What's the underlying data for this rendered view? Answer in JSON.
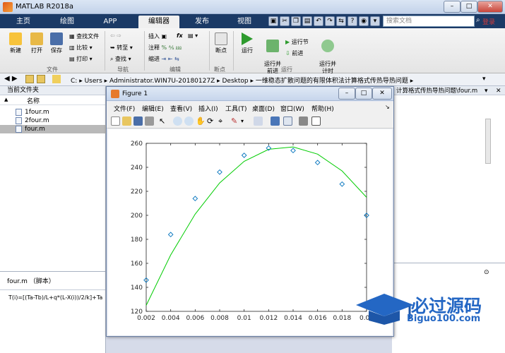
{
  "window": {
    "title": "MATLAB R2018a",
    "minimize": "–",
    "maximize": "□",
    "close": "✕"
  },
  "tabs": [
    {
      "label": "主页"
    },
    {
      "label": "绘图"
    },
    {
      "label": "APP"
    },
    {
      "label": "编辑器",
      "active": true
    },
    {
      "label": "发布"
    },
    {
      "label": "视图"
    }
  ],
  "search": {
    "placeholder": "搜索文档"
  },
  "login": "登录",
  "ribbon": {
    "file_group": "文件",
    "nav_group": "导航",
    "edit_group": "编辑",
    "bp_group": "断点",
    "run_group": "运行",
    "new": "新建",
    "open": "打开",
    "save": "保存",
    "find_files": "查找文件",
    "compare": "比较",
    "print": "打印",
    "goto": "转至",
    "find": "查找",
    "insert": "插入",
    "comment": "注释",
    "indent": "缩进",
    "fx": "fx",
    "breakpoints": "断点",
    "run": "运行",
    "run_advance": "运行并\n前进",
    "run_section": "运行节",
    "advance": "前进",
    "run_time": "运行并\n计时"
  },
  "address": {
    "crumbs": [
      "C:",
      "Users",
      "Administrator.WIN7U-20180127Z",
      "Desktop",
      "一维稳态扩散问题的有限体积法计算格式传热导热问题"
    ]
  },
  "files": {
    "header": "当前文件夹",
    "col_name": "名称",
    "sort": "▲",
    "items": [
      {
        "name": "1four.m"
      },
      {
        "name": "2four.m"
      },
      {
        "name": "four.m",
        "selected": true
      }
    ]
  },
  "details": {
    "title": "four.m （脚本）",
    "code": "T(i)=[(Ta-Tb)/L+q*(L-X(i))/2/k]+Ta"
  },
  "editor": {
    "tab_title": "计算格式传热导热问题\\four.m"
  },
  "figure": {
    "title": "Figure 1",
    "menus": [
      "文件(F)",
      "编辑(E)",
      "查看(V)",
      "插入(I)",
      "工具(T)",
      "桌面(D)",
      "窗口(W)",
      "帮助(H)"
    ],
    "line_color": "#00cc00",
    "marker_color": "#0072bd"
  },
  "chart_data": {
    "type": "line",
    "x_ticks": [
      "0.002",
      "0.004",
      "0.006",
      "0.008",
      "0.01",
      "0.012",
      "0.014",
      "0.016",
      "0.018",
      "0.02"
    ],
    "y_ticks": [
      "120",
      "140",
      "160",
      "180",
      "200",
      "220",
      "240",
      "260"
    ],
    "xlim": [
      0.002,
      0.02
    ],
    "ylim": [
      120,
      260
    ],
    "series": [
      {
        "style": "line",
        "x": [
          0.002,
          0.004,
          0.006,
          0.008,
          0.01,
          0.012,
          0.014,
          0.016,
          0.018,
          0.02
        ],
        "values": [
          125,
          167,
          201,
          227,
          245,
          255,
          257,
          251,
          237,
          215
        ]
      },
      {
        "style": "markers",
        "x": [
          0.002,
          0.004,
          0.006,
          0.008,
          0.01,
          0.012,
          0.014,
          0.016,
          0.018,
          0.02
        ],
        "values": [
          146,
          184,
          214,
          236,
          250,
          256,
          254,
          244,
          226,
          200
        ]
      }
    ]
  },
  "watermark": {
    "text": "必过源码",
    "url": "Biguo100.com"
  }
}
